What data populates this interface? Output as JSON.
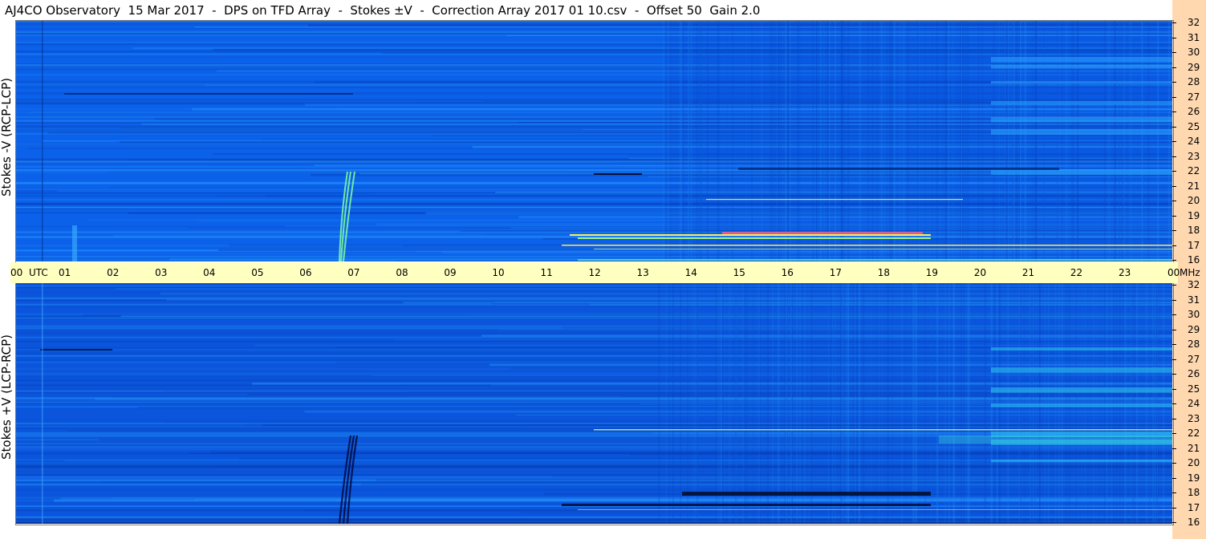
{
  "title": "AJ4CO Observatory  15 Mar 2017  -  DPS on TFD Array  -  Stokes ±V  -  Correction Array 2017 01 10.csv  -  Offset 50  Gain 2.0",
  "colors": {
    "bg": "#0a5ce6",
    "time_strip": "#ffffc0",
    "freq_strip": "#ffd8b0"
  },
  "chart_data": [
    {
      "type": "heatmap",
      "ylabel": "Stokes -V (RCP-LCP)",
      "x_ticks": [
        "00",
        "01",
        "02",
        "03",
        "04",
        "05",
        "06",
        "07",
        "08",
        "09",
        "10",
        "11",
        "12",
        "13",
        "14",
        "15",
        "16",
        "17",
        "18",
        "19",
        "20",
        "21",
        "22",
        "23",
        "00"
      ],
      "x_unit": "UTC",
      "y_ticks": [
        32,
        31,
        30,
        29,
        28,
        27,
        26,
        25,
        24,
        23,
        22,
        21,
        20,
        19,
        18,
        17,
        16
      ],
      "y_unit": "MHz",
      "xlim": [
        0,
        24
      ],
      "ylim": [
        16,
        32
      ]
    },
    {
      "type": "heatmap",
      "ylabel": "Stokes +V (LCP-RCP)",
      "x_ticks": [
        "00",
        "01",
        "02",
        "03",
        "04",
        "05",
        "06",
        "07",
        "08",
        "09",
        "10",
        "11",
        "12",
        "13",
        "14",
        "15",
        "16",
        "17",
        "18",
        "19",
        "20",
        "21",
        "22",
        "23",
        "00"
      ],
      "x_unit": "UTC",
      "y_ticks": [
        32,
        31,
        30,
        29,
        28,
        27,
        26,
        25,
        24,
        23,
        22,
        21,
        20,
        19,
        18,
        17,
        16
      ],
      "y_unit": "MHz",
      "xlim": [
        0,
        24
      ],
      "ylim": [
        16,
        32
      ]
    }
  ]
}
